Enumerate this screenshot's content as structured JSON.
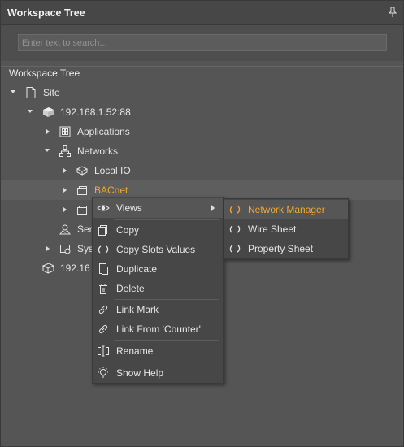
{
  "panel": {
    "title": "Workspace Tree",
    "pin_glyph": "‡"
  },
  "search": {
    "placeholder": "Enter text to search..."
  },
  "section": {
    "label": "Workspace Tree"
  },
  "tree": {
    "site": "Site",
    "station": "192.168.1.52:88",
    "applications": "Applications",
    "networks": "Networks",
    "local_io": "Local IO",
    "bacnet": "BACnet",
    "services_partial": "Ser",
    "system_partial": "Sys",
    "station2_partial": "192.16"
  },
  "context_menu": {
    "views": "Views",
    "copy": "Copy",
    "copy_slots": "Copy Slots Values",
    "duplicate": "Duplicate",
    "delete": "Delete",
    "link_mark": "Link Mark",
    "link_from": "Link From 'Counter'",
    "rename": "Rename",
    "show_help": "Show Help"
  },
  "submenu": {
    "network_manager": "Network Manager",
    "wire_sheet": "Wire Sheet",
    "property_sheet": "Property Sheet"
  },
  "colors": {
    "accent": "#f0a830",
    "background": "#555555",
    "menu": "#474747"
  }
}
